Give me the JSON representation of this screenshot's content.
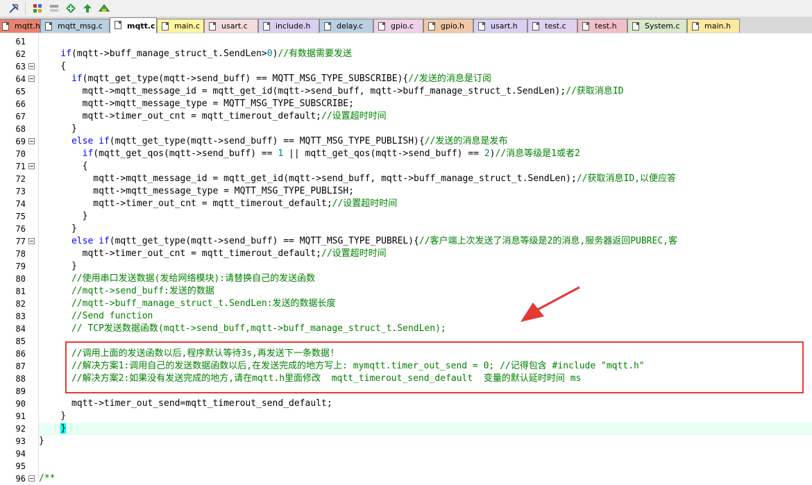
{
  "tabs": [
    {
      "label": "mqtt.h",
      "color": "#e8826e"
    },
    {
      "label": "mqtt_msg.c",
      "color": "#b8d0e0"
    },
    {
      "label": "mqtt.c",
      "color": "#ffffff",
      "active": true
    },
    {
      "label": "main.c",
      "color": "#fff6a0"
    },
    {
      "label": "usart.c",
      "color": "#f3dcdc"
    },
    {
      "label": "include.h",
      "color": "#d8d0f0"
    },
    {
      "label": "delay.c",
      "color": "#b8d0e0"
    },
    {
      "label": "gpio.c",
      "color": "#f0d0e8"
    },
    {
      "label": "gpio.h",
      "color": "#f0c8a8"
    },
    {
      "label": "usart.h",
      "color": "#d8d0f0"
    },
    {
      "label": "test.c",
      "color": "#e0d0f0"
    },
    {
      "label": "test.h",
      "color": "#f0c0c8"
    },
    {
      "label": "System.c",
      "color": "#d8e8c8"
    },
    {
      "label": "main.h",
      "color": "#ffe8a0"
    }
  ],
  "toolbar_icons": [
    "tools-icon",
    "load-icon",
    "rebuild-icon",
    "download-icon",
    "debug-icon",
    "target-icon"
  ],
  "lines": [
    {
      "n": "61",
      "segs": []
    },
    {
      "n": "62",
      "segs": [
        [
          "    ",
          ""
        ],
        [
          "if",
          "kw"
        ],
        [
          "(mqtt->buff_manage_struct_t.SendLen>",
          ""
        ],
        [
          "0",
          "num"
        ],
        [
          ")",
          ""
        ],
        [
          "//有数据需要发送",
          "cm"
        ]
      ]
    },
    {
      "n": "63",
      "fold": true,
      "segs": [
        [
          "    {",
          ""
        ]
      ]
    },
    {
      "n": "64",
      "fold": true,
      "segs": [
        [
          "      ",
          ""
        ],
        [
          "if",
          "kw"
        ],
        [
          "(mqtt_get_type(mqtt->send_buff) == MQTT_MSG_TYPE_SUBSCRIBE){",
          ""
        ],
        [
          "//发送的消息是订阅",
          "cm"
        ]
      ]
    },
    {
      "n": "65",
      "segs": [
        [
          "        mqtt->mqtt_message_id = mqtt_get_id(mqtt->send_buff, mqtt->buff_manage_struct_t.SendLen);",
          ""
        ],
        [
          "//获取消息ID",
          "cm"
        ]
      ]
    },
    {
      "n": "66",
      "segs": [
        [
          "        mqtt->mqtt_message_type = MQTT_MSG_TYPE_SUBSCRIBE;",
          ""
        ]
      ]
    },
    {
      "n": "67",
      "segs": [
        [
          "        mqtt->timer_out_cnt = mqtt_timerout_default;",
          ""
        ],
        [
          "//设置超时时间",
          "cm"
        ]
      ]
    },
    {
      "n": "68",
      "segs": [
        [
          "      }",
          ""
        ]
      ]
    },
    {
      "n": "69",
      "fold": true,
      "segs": [
        [
          "      ",
          ""
        ],
        [
          "else if",
          "kw"
        ],
        [
          "(mqtt_get_type(mqtt->send_buff) == MQTT_MSG_TYPE_PUBLISH){",
          ""
        ],
        [
          "//发送的消息是发布",
          "cm"
        ]
      ]
    },
    {
      "n": "70",
      "segs": [
        [
          "        ",
          ""
        ],
        [
          "if",
          "kw"
        ],
        [
          "(mqtt_get_qos(mqtt->send_buff) == ",
          ""
        ],
        [
          "1",
          "num"
        ],
        [
          " || mqtt_get_qos(mqtt->send_buff) == ",
          ""
        ],
        [
          "2",
          "num"
        ],
        [
          ")",
          ""
        ],
        [
          "//消息等级是1或者2",
          "cm"
        ]
      ]
    },
    {
      "n": "71",
      "fold": true,
      "segs": [
        [
          "        {",
          ""
        ]
      ]
    },
    {
      "n": "72",
      "segs": [
        [
          "          mqtt->mqtt_message_id = mqtt_get_id(mqtt->send_buff, mqtt->buff_manage_struct_t.SendLen);",
          ""
        ],
        [
          "//获取消息ID,以便应答",
          "cm"
        ]
      ]
    },
    {
      "n": "73",
      "segs": [
        [
          "          mqtt->mqtt_message_type = MQTT_MSG_TYPE_PUBLISH;",
          ""
        ]
      ]
    },
    {
      "n": "74",
      "segs": [
        [
          "          mqtt->timer_out_cnt = mqtt_timerout_default;",
          ""
        ],
        [
          "//设置超时时间",
          "cm"
        ]
      ]
    },
    {
      "n": "75",
      "segs": [
        [
          "        }",
          ""
        ]
      ]
    },
    {
      "n": "76",
      "segs": [
        [
          "      }",
          ""
        ]
      ]
    },
    {
      "n": "77",
      "fold": true,
      "segs": [
        [
          "      ",
          ""
        ],
        [
          "else if",
          "kw"
        ],
        [
          "(mqtt_get_type(mqtt->send_buff) == MQTT_MSG_TYPE_PUBREL){",
          ""
        ],
        [
          "//客户端上次发送了消息等级是2的消息,服务器返回PUBREC,客",
          "cm"
        ]
      ]
    },
    {
      "n": "78",
      "segs": [
        [
          "        mqtt->timer_out_cnt = mqtt_timerout_default;",
          ""
        ],
        [
          "//设置超时时间",
          "cm"
        ]
      ]
    },
    {
      "n": "79",
      "segs": [
        [
          "      }",
          ""
        ]
      ]
    },
    {
      "n": "80",
      "segs": [
        [
          "      ",
          ""
        ],
        [
          "//使用串口发送数据(发给网络模块):请替换自己的发送函数",
          "cm"
        ]
      ]
    },
    {
      "n": "81",
      "segs": [
        [
          "      ",
          ""
        ],
        [
          "//mqtt->send_buff:发送的数据",
          "cm"
        ]
      ]
    },
    {
      "n": "82",
      "segs": [
        [
          "      ",
          ""
        ],
        [
          "//mqtt->buff_manage_struct_t.SendLen:发送的数据长度",
          "cm"
        ]
      ]
    },
    {
      "n": "83",
      "segs": [
        [
          "      ",
          ""
        ],
        [
          "//Send function",
          "cm"
        ]
      ]
    },
    {
      "n": "84",
      "segs": [
        [
          "      ",
          ""
        ],
        [
          "// TCP发送数据函数(mqtt->send_buff,mqtt->buff_manage_struct_t.SendLen);",
          "cm"
        ]
      ]
    },
    {
      "n": "85",
      "segs": []
    },
    {
      "n": "86",
      "segs": [
        [
          "      ",
          ""
        ],
        [
          "//调用上面的发送函数以后,程序默认等待3s,再发送下一条数据!",
          "cm"
        ]
      ]
    },
    {
      "n": "87",
      "segs": [
        [
          "      ",
          ""
        ],
        [
          "//解决方案1:调用自己的发送数据函数以后,在发送完成的地方写上: mymqtt.timer_out_send = 0; //记得包含 #include \"mqtt.h\"",
          "cm"
        ]
      ]
    },
    {
      "n": "88",
      "segs": [
        [
          "      ",
          ""
        ],
        [
          "//解决方案2:如果没有发送完成的地方,请在mqtt.h里面修改  mqtt_timerout_send_default  变量的默认延时时间 ms",
          "cm"
        ]
      ]
    },
    {
      "n": "89",
      "segs": []
    },
    {
      "n": "90",
      "segs": [
        [
          "      mqtt->timer_out_send=mqtt_timerout_send_default;",
          ""
        ]
      ]
    },
    {
      "n": "91",
      "segs": [
        [
          "    }",
          ""
        ]
      ]
    },
    {
      "n": "92",
      "current": true,
      "segs": [
        [
          "    ",
          ""
        ],
        [
          "}",
          "brace"
        ]
      ]
    },
    {
      "n": "93",
      "segs": [
        [
          "}",
          ""
        ]
      ]
    },
    {
      "n": "94",
      "segs": []
    },
    {
      "n": "95",
      "segs": []
    },
    {
      "n": "96",
      "fold": true,
      "segs": [
        [
          "/**",
          "cm"
        ]
      ]
    }
  ]
}
